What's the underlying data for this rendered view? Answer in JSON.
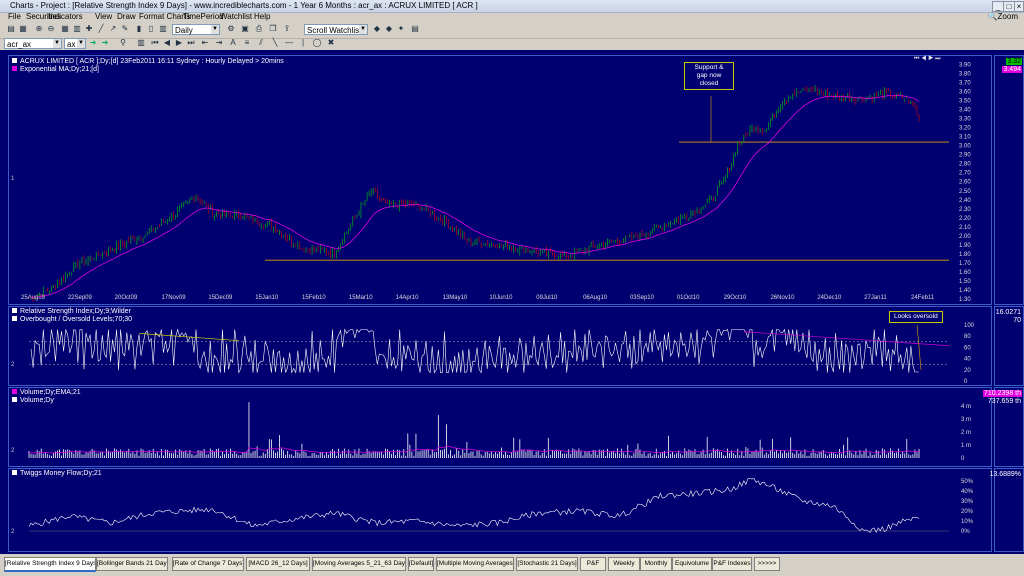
{
  "window": {
    "title": "Charts - Project : [Relative Strength Index 9 Days] - www.incrediblecharts.com - 1 Year 6 Months : acr_ax : ACRUX LIMITED [ ACR ]"
  },
  "menu": [
    "File",
    "Securities",
    "Indicators",
    "View",
    "Draw",
    "Format Charts",
    "TimePeriod",
    "Watchlist",
    "Help"
  ],
  "zoom_label": "Zoom",
  "toolbar": {
    "period": "Daily",
    "watchlist": "Scroll Watchlist",
    "symbol": "acr_ax",
    "exchange": "ax"
  },
  "price_panel": {
    "legend1": "ACRUX LIMITED [ ACR ];Dy;[d]  23Feb2011 16:11 Sydney : Hourly Delayed > 20mins",
    "legend2": "Exponential MA;Dy;21;[d]",
    "last_price": "3.32",
    "ma_value": "3.494",
    "y_ticks": [
      "3.90",
      "3.80",
      "3.70",
      "3.60",
      "3.50",
      "3.40",
      "3.30",
      "3.20",
      "3.10",
      "3.00",
      "2.90",
      "2.80",
      "2.70",
      "2.60",
      "2.50",
      "2.40",
      "2.30",
      "2.20",
      "2.10",
      "2.00",
      "1.90",
      "1.80",
      "1.70",
      "1.60",
      "1.50",
      "1.40",
      "1.30"
    ],
    "x_labels": [
      "25Aug09",
      "22Sep09",
      "20Oct09",
      "17Nov09",
      "15Dec09",
      "15Jan10",
      "15Feb10",
      "15Mar10",
      "14Apr10",
      "13May10",
      "10Jun10",
      "09Jul10",
      "06Aug10",
      "03Sep10",
      "01Oct10",
      "29Oct10",
      "26Nov10",
      "24Dec10",
      "27Jan11",
      "24Feb11"
    ],
    "annotation": "Support & gap now closed",
    "support_top": 3.04,
    "support_bottom": 1.73,
    "panel_number": "1"
  },
  "rsi_panel": {
    "legend1": "Relative Strength Index;Dy;9;Wilder",
    "legend2": "Overbought / Oversold Levels;70;30",
    "value1": "16.0271",
    "value2": "70",
    "y_ticks": [
      "100",
      "80",
      "60",
      "40",
      "20",
      "0"
    ],
    "annotation": "Looks oversold",
    "panel_number": "2"
  },
  "volume_panel": {
    "legend1": "Volume;Dy;EMA;21",
    "legend2": "Volume;Dy",
    "value1": "710.2398 th",
    "value2": "737.659 th",
    "y_ticks": [
      "4 m",
      "3 m",
      "2 m",
      "1 m",
      "0"
    ],
    "panel_number": "2"
  },
  "tmf_panel": {
    "legend1": "Twiggs Money Flow;Dy;21",
    "value1": "13.6889%",
    "y_ticks": [
      "50%",
      "40%",
      "30%",
      "20%",
      "10%",
      "0%"
    ],
    "panel_number": "2"
  },
  "tabs": [
    "Relative Strength Index 9 Days",
    "Bollinger Bands 21 Days",
    "Rate of Change 7 Days",
    "MACD 26_12 Days",
    "Moving Averages 5_21_63 Days",
    "Default",
    "Multiple Moving Averages",
    "Stochastic 21 Days",
    "P&F",
    "Weekly",
    "Monthly",
    "Equivolume",
    "P&F Indexes",
    ">>>>>"
  ],
  "colors": {
    "background": "#000070",
    "up": "#00d000",
    "down": "#e00000",
    "ma": "#e000e0",
    "support": "#e0a000",
    "rsi_trend": "#d000d0",
    "rsi_trend_early": "#d0d000"
  }
}
